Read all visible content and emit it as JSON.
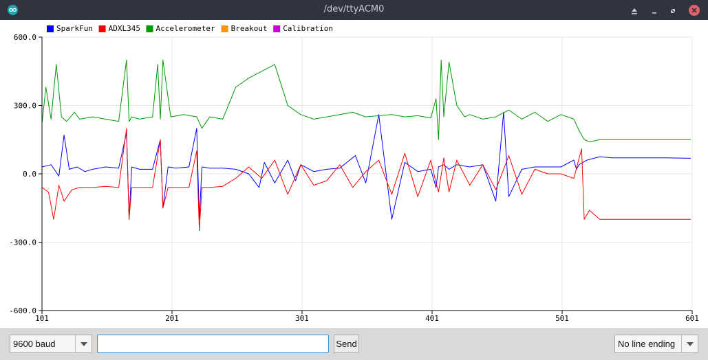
{
  "window": {
    "title": "/dev/ttyACM0"
  },
  "legend": [
    {
      "label": "SparkFun",
      "color": "#0000ff"
    },
    {
      "label": "ADXL345",
      "color": "#ff0000"
    },
    {
      "label": "Accelerometer",
      "color": "#009900"
    },
    {
      "label": "Breakout",
      "color": "#ff9900"
    },
    {
      "label": "Calibration",
      "color": "#cc00cc"
    }
  ],
  "chart_data": {
    "type": "line",
    "y_ticks": [
      "600.0",
      "300.0",
      "0.0",
      "-300.0",
      "-600.0"
    ],
    "x_ticks": [
      "101",
      "201",
      "301",
      "401",
      "501",
      "601"
    ],
    "xlim": [
      101,
      601
    ],
    "ylim": [
      -600,
      600
    ],
    "grid": true,
    "series": [
      {
        "name": "SparkFun",
        "color": "#0000ff",
        "x": [
          101,
          108,
          114,
          118,
          122,
          128,
          134,
          140,
          150,
          160,
          166,
          168,
          170,
          176,
          186,
          192,
          194,
          198,
          204,
          214,
          220,
          222,
          224,
          230,
          240,
          250,
          260,
          268,
          272,
          280,
          290,
          296,
          300,
          310,
          320,
          330,
          342,
          350,
          360,
          370,
          380,
          390,
          400,
          404,
          406,
          410,
          414,
          420,
          430,
          440,
          450,
          456,
          460,
          470,
          480,
          500,
          510,
          512,
          514,
          520,
          530,
          540,
          560,
          580,
          600
        ],
        "values": [
          30,
          40,
          -10,
          170,
          20,
          30,
          10,
          20,
          30,
          25,
          180,
          -200,
          30,
          20,
          20,
          150,
          -150,
          30,
          25,
          30,
          200,
          -200,
          30,
          25,
          25,
          20,
          0,
          -60,
          50,
          -40,
          60,
          -30,
          40,
          10,
          20,
          25,
          80,
          -40,
          260,
          -200,
          50,
          10,
          20,
          -60,
          30,
          40,
          20,
          40,
          30,
          40,
          -120,
          270,
          -100,
          20,
          30,
          30,
          60,
          20,
          40,
          60,
          75,
          70,
          70,
          70,
          68
        ]
      },
      {
        "name": "ADXL345",
        "color": "#ff0000",
        "x": [
          101,
          106,
          110,
          114,
          118,
          124,
          130,
          140,
          150,
          160,
          166,
          168,
          170,
          176,
          186,
          192,
          194,
          198,
          204,
          214,
          220,
          222,
          224,
          230,
          240,
          250,
          260,
          270,
          280,
          290,
          300,
          310,
          320,
          330,
          340,
          350,
          360,
          370,
          380,
          390,
          400,
          404,
          406,
          410,
          414,
          420,
          430,
          440,
          450,
          460,
          470,
          480,
          490,
          500,
          510,
          516,
          518,
          522,
          530,
          540,
          560,
          580,
          600
        ],
        "values": [
          -60,
          -80,
          -200,
          -50,
          -120,
          -70,
          -60,
          -60,
          -55,
          -60,
          200,
          -200,
          -60,
          -60,
          -60,
          150,
          -150,
          -60,
          -60,
          -60,
          100,
          -250,
          -60,
          -60,
          -55,
          -20,
          30,
          -20,
          60,
          -90,
          40,
          -50,
          -30,
          40,
          -60,
          10,
          60,
          -90,
          90,
          -100,
          60,
          -40,
          -80,
          70,
          -80,
          60,
          -50,
          40,
          -70,
          80,
          -90,
          20,
          0,
          0,
          -20,
          110,
          -200,
          -160,
          -200,
          -200,
          -200,
          -200,
          -200
        ]
      },
      {
        "name": "Accelerometer",
        "color": "#009900",
        "x": [
          101,
          104,
          108,
          112,
          116,
          120,
          126,
          130,
          140,
          150,
          160,
          166,
          168,
          170,
          176,
          186,
          190,
          192,
          194,
          200,
          210,
          220,
          224,
          230,
          240,
          250,
          260,
          270,
          280,
          290,
          300,
          310,
          320,
          330,
          340,
          350,
          360,
          370,
          380,
          390,
          400,
          404,
          406,
          408,
          410,
          414,
          420,
          426,
          430,
          440,
          450,
          460,
          470,
          480,
          490,
          500,
          510,
          514,
          518,
          522,
          530,
          540,
          560,
          580,
          600
        ],
        "values": [
          220,
          380,
          240,
          480,
          250,
          230,
          270,
          240,
          250,
          240,
          230,
          500,
          230,
          250,
          240,
          250,
          480,
          240,
          500,
          250,
          260,
          250,
          200,
          250,
          240,
          380,
          420,
          450,
          480,
          300,
          260,
          240,
          250,
          260,
          270,
          250,
          255,
          260,
          250,
          255,
          245,
          330,
          150,
          500,
          250,
          490,
          300,
          250,
          260,
          240,
          250,
          280,
          240,
          270,
          230,
          260,
          240,
          190,
          150,
          140,
          150,
          150,
          150,
          150,
          150
        ]
      }
    ]
  },
  "controls": {
    "baud": {
      "value": "9600 baud"
    },
    "line_ending": {
      "value": "No line ending"
    },
    "send_label": "Send",
    "input_value": ""
  },
  "colors": {
    "titlebar": "#2f343f",
    "close": "#e0636b",
    "grid": "#e6e6e6"
  }
}
